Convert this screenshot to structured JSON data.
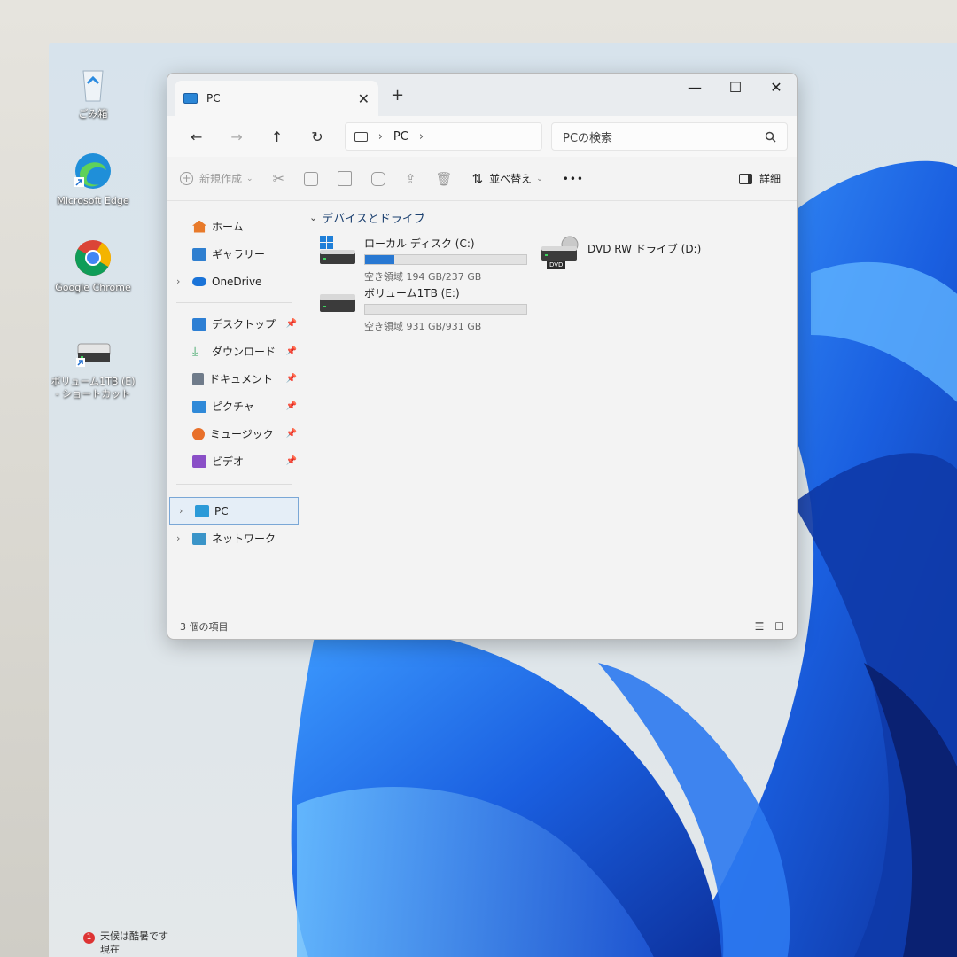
{
  "desktop": {
    "icons": [
      {
        "label": "ごみ箱"
      },
      {
        "label": "Microsoft Edge"
      },
      {
        "label": "Google Chrome"
      },
      {
        "label": "ボリューム1TB (E) - ショートカット"
      }
    ]
  },
  "window": {
    "tab_title": "PC",
    "controls": {
      "minimize": "—",
      "maximize": "☐",
      "close": "✕",
      "new_tab": "+",
      "tab_close": "✕"
    },
    "address": {
      "segment": "PC"
    },
    "search": {
      "placeholder": "PCの検索"
    },
    "toolbar": {
      "new_label": "新規作成",
      "sort_label": "並べ替え",
      "more_label": "•••",
      "details_label": "詳細"
    },
    "nav": {
      "home": "ホーム",
      "gallery": "ギャラリー",
      "onedrive": "OneDrive",
      "quick": [
        {
          "label": "デスクトップ",
          "color": "#2d7fd4"
        },
        {
          "label": "ダウンロード",
          "color": "#2a9d57"
        },
        {
          "label": "ドキュメント",
          "color": "#6f7b8a"
        },
        {
          "label": "ピクチャ",
          "color": "#2f89d8"
        },
        {
          "label": "ミュージック",
          "color": "#e8702a"
        },
        {
          "label": "ビデオ",
          "color": "#8a4fc7"
        }
      ],
      "pc": "PC",
      "network": "ネットワーク"
    },
    "content": {
      "group_title": "デバイスとドライブ",
      "drives": [
        {
          "name": "ローカル ディスク (C:)",
          "free": "空き領域 194 GB/237 GB",
          "used_fraction": 0.18
        },
        {
          "name": "ボリューム1TB (E:)",
          "free": "空き領域 931 GB/931 GB",
          "used_fraction": 0.0
        },
        {
          "name": "DVD RW ドライブ (D:)",
          "badge": "DVD"
        }
      ]
    },
    "status": {
      "items": "3 個の項目"
    }
  },
  "taskbar": {
    "weather_line1": "天候は酷暑です",
    "weather_line2": "現在",
    "weather_badge": "1"
  },
  "colors": {
    "accent": "#2878d2",
    "wallpaper": "#1a5fe0"
  }
}
